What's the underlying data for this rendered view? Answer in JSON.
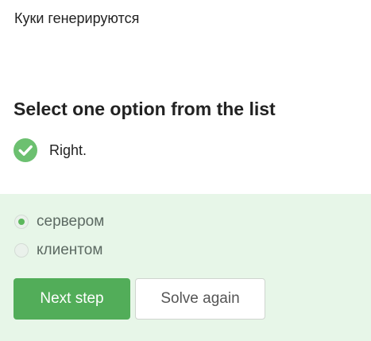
{
  "question": {
    "text": "Куки генерируются"
  },
  "task": {
    "heading": "Select one option from the list"
  },
  "result": {
    "text": "Right.",
    "icon": "check-circle-icon",
    "icon_color": "#6cc070"
  },
  "options": [
    {
      "label": "сервером",
      "selected": true
    },
    {
      "label": "клиентом",
      "selected": false
    }
  ],
  "buttons": {
    "next_label": "Next step",
    "solve_again_label": "Solve again"
  },
  "colors": {
    "accent": "#52ad59",
    "panel_background": "#e7f6e8"
  }
}
